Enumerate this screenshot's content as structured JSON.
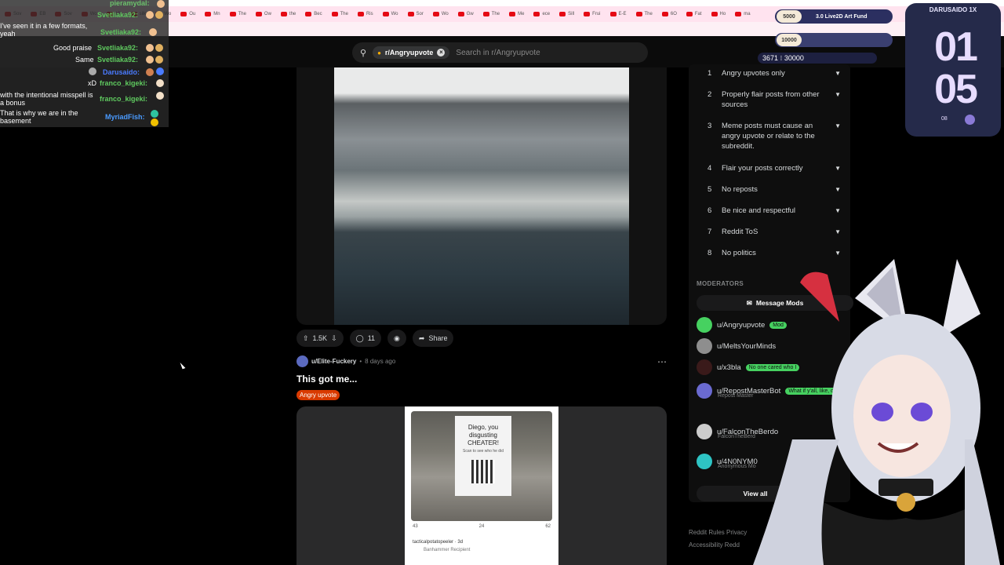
{
  "bookmarks": [
    "Sov",
    "EB",
    "Sov",
    "Wo",
    "13l",
    "silk",
    "Wo",
    "Ou",
    "Mn",
    "The",
    "Ow",
    "the",
    "Bec",
    "The",
    "Ris",
    "Wo",
    "Sor",
    "Wo",
    "Gw",
    "The",
    "Me",
    "ece",
    "Sill",
    "Frui",
    "E-E",
    "The",
    "6O",
    "Fat",
    "Ho",
    "ma"
  ],
  "search": {
    "community": "r/Angryupvote",
    "placeholder": "Search in r/Angryupvote"
  },
  "post1": {
    "upvotes": "1.5K",
    "comments": "11",
    "share_label": "Share"
  },
  "post2": {
    "author": "u/Elite-Fuckery",
    "time": "8 days ago",
    "title": "This got me...",
    "flair": "Angry upvote",
    "poster_text": "Diego, you disgusting CHEATER!",
    "poster_sub": "Scan to see who he did",
    "card_votes": "43",
    "card_comments": "24",
    "card_shares": "62",
    "card_comment_user": "tacticalpotatopeeler · 3d",
    "card_comment_badge": "Banhammer Recipient"
  },
  "rules": [
    {
      "num": "1",
      "text": "Angry upvotes only"
    },
    {
      "num": "2",
      "text": "Properly flair posts from other sources"
    },
    {
      "num": "3",
      "text": "Meme posts must cause an angry upvote or relate to the subreddit."
    },
    {
      "num": "4",
      "text": "Flair your posts correctly"
    },
    {
      "num": "5",
      "text": "No reposts"
    },
    {
      "num": "6",
      "text": "Be nice and respectful"
    },
    {
      "num": "7",
      "text": "Reddit ToS"
    },
    {
      "num": "8",
      "text": "No politics"
    }
  ],
  "moderators": {
    "heading": "MODERATORS",
    "message_label": "Message Mods",
    "list": [
      {
        "name": "u/Angryupvote",
        "flair": "Mod",
        "sub": ""
      },
      {
        "name": "u/MeltsYourMinds",
        "flair": "",
        "sub": ""
      },
      {
        "name": "u/x3bla",
        "flair": "No one cared who I",
        "sub": ""
      },
      {
        "name": "u/RepostMasterBot",
        "flair": "What if y'all, like, didn't re",
        "sub": "Repost Master"
      },
      {
        "name": "u/FalconTheBerdo",
        "flair": "",
        "sub": "FalconTheBerd"
      },
      {
        "name": "u/4N0NYM0",
        "flair": "",
        "sub": "Anonymous Mo"
      }
    ],
    "view_all": "View all"
  },
  "footer": {
    "line1": "Reddit Rules  Privacy",
    "line2": "Accessibility  Redd"
  },
  "chat": [
    {
      "user": "pieramydal:",
      "msg": ""
    },
    {
      "user": "",
      "msg": "I've seen it in a few formats, yeah"
    },
    {
      "user": "Svetliaka92:",
      "msg": ""
    },
    {
      "user": "Svetliaka92:",
      "msg": ""
    },
    {
      "user": "Svetliaka92:",
      "msg": "Good praise"
    },
    {
      "user": "Svetliaka92:",
      "msg": "Same"
    },
    {
      "user": "Darusaido:",
      "msg": ""
    },
    {
      "user": "franco_kigeki:",
      "msg": "xD"
    },
    {
      "user": "franco_kigeki:",
      "msg": "with the intentional misspell is a bonus"
    },
    {
      "user": "MyriadFish:",
      "msg": "That is why we are in the basement"
    }
  ],
  "goals": {
    "goal1_badge": "5000",
    "goal1_text": "3.0 Live2D Art Fund",
    "goal2_badge": "10000",
    "counter": "3671 ⁝ 30000"
  },
  "clock": {
    "title": "DARUSAIDO 1X",
    "hours": "01",
    "minutes": "05",
    "seconds": "08"
  },
  "colors": {
    "accent_flair": "#d93a00",
    "mod_flair": "#46d160",
    "chat_name": "#5fc95f",
    "clock_bg": "#252a4a"
  }
}
